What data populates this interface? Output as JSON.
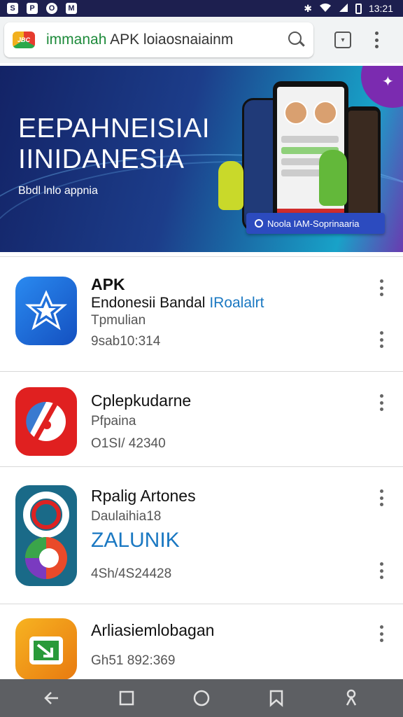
{
  "status_bar": {
    "time": "13:21",
    "icons": [
      "notification-icon",
      "notification-icon",
      "notification-icon",
      "notification-icon",
      "bluetooth-icon",
      "wifi-icon",
      "signal-icon",
      "battery-icon"
    ]
  },
  "address_bar": {
    "url_host": "immanah",
    "url_rest": "APK loiaosnaiainm",
    "logo_text": "JBC"
  },
  "banner": {
    "title_line1": "EEPAHNEISIAI",
    "title_line2": "IINIDANESIA",
    "subtitle": "Bbdl lnlo appnia",
    "button_label": "Noola IAM-Soprinaaria",
    "colors": {
      "start": "#132366",
      "end": "#18a2c8"
    }
  },
  "apps": [
    {
      "name": "APK",
      "line2": "Endonesii Bandal",
      "tag": "IRoalalrt",
      "line3": "Tpmulian",
      "line4": "9sab10:314",
      "icon": "star-badge-icon",
      "icon_color": "#1e6fe0"
    },
    {
      "name": "Cplepkudarne",
      "line2": "Pfpaina",
      "line3": "O1SI/ 42340",
      "icon": "speed-icon",
      "icon_color": "#e02020"
    },
    {
      "name": "Rpalig Artones",
      "line2": "Daulaihia18",
      "highlight": "ZALUNIK",
      "line4": "4Sh/4S24428",
      "icon": "rings-icon",
      "icon_color": "#1a6a88"
    },
    {
      "name": "Arliasiemlobagan",
      "line3": "Gh51 892:369",
      "icon": "download-icon",
      "icon_color": "#f0a020"
    }
  ],
  "nav_bar": {
    "buttons": [
      "back",
      "home-square",
      "circle",
      "bookmark",
      "person"
    ]
  }
}
